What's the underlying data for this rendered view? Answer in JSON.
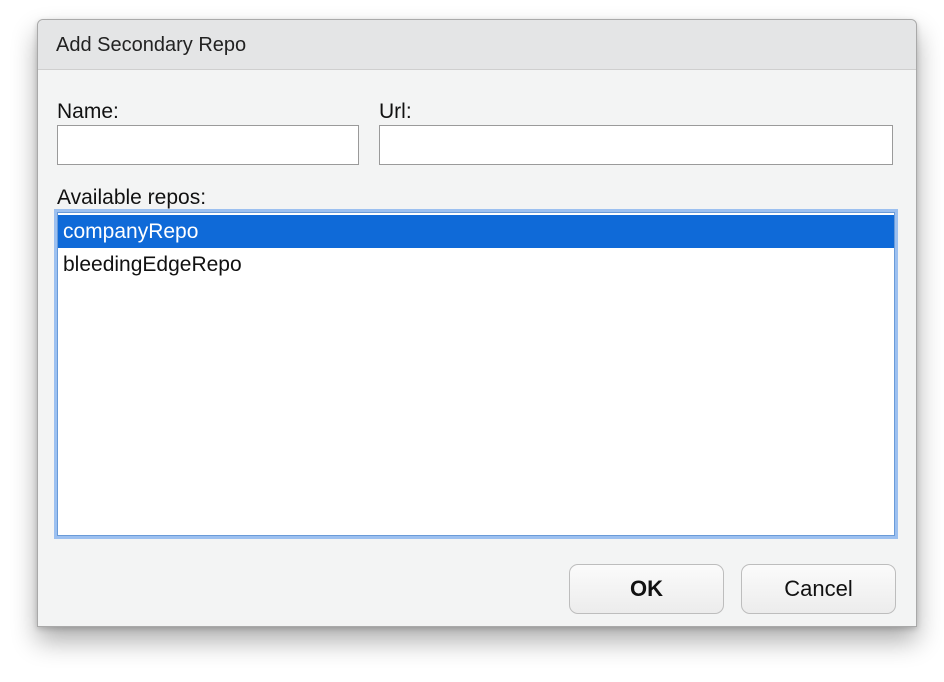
{
  "dialog": {
    "title": "Add Secondary Repo"
  },
  "form": {
    "name_label": "Name:",
    "name_value": "",
    "url_label": "Url:",
    "url_value": "",
    "available_label": "Available repos:"
  },
  "repos": {
    "items": [
      {
        "label": "companyRepo",
        "selected": true
      },
      {
        "label": "bleedingEdgeRepo",
        "selected": false
      }
    ]
  },
  "buttons": {
    "ok_label": "OK",
    "cancel_label": "Cancel"
  },
  "colors": {
    "selection": "#0f6ad8",
    "focus_ring": "#9cc0f0"
  }
}
